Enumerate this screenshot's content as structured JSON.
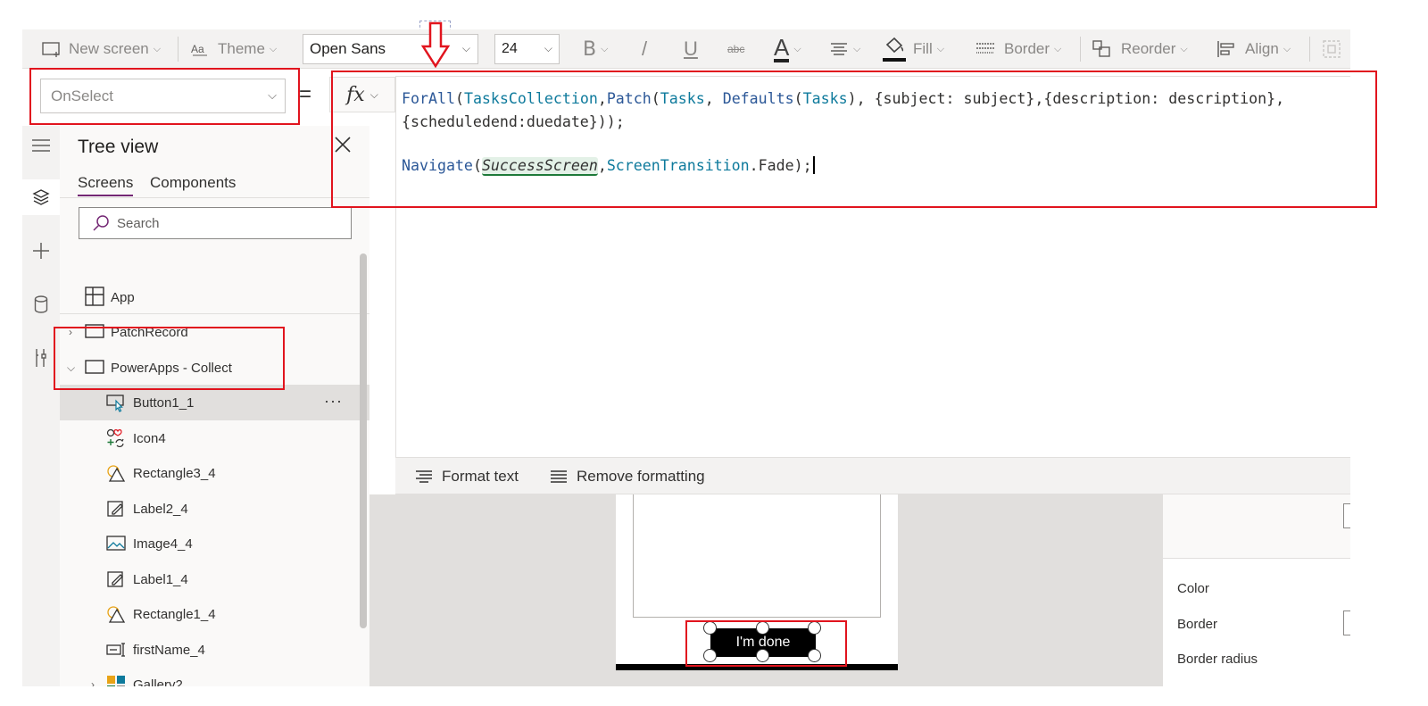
{
  "toolbar": {
    "new_screen": "New screen",
    "theme": "Theme",
    "font": "Open Sans",
    "font_size": "24",
    "bold": "B",
    "italic": "/",
    "underline": "U",
    "strikethrough": "abc",
    "font_color": "A",
    "fill": "Fill",
    "border": "Border",
    "reorder": "Reorder",
    "align": "Align"
  },
  "formula_bar": {
    "property": "OnSelect",
    "equals": "=",
    "fx": "fx",
    "code": {
      "l1_fn1": "ForAll",
      "l1_p1": "(",
      "l1_tk1": "TasksCollection",
      "l1_p2": ",",
      "l1_fn2": "Patch",
      "l1_p3": "(",
      "l1_tk2": "Tasks",
      "l1_p4": ", ",
      "l1_fn3": "Defaults",
      "l1_p5": "(",
      "l1_tk3": "Tasks",
      "l1_rest": "), {subject: subject},{description: description},",
      "l2": "{scheduledend:duedate}));",
      "l3_fn": "Navigate",
      "l3_p1": "(",
      "l3_screen": "SuccessScreen",
      "l3_p2": ",",
      "l3_tk": "ScreenTransition",
      "l3_rest": ".Fade);"
    }
  },
  "format_bar": {
    "format_text": "Format text",
    "remove_formatting": "Remove formatting"
  },
  "tree_view": {
    "title": "Tree view",
    "tabs": [
      "Screens",
      "Components"
    ],
    "search_placeholder": "Search",
    "items": [
      {
        "label": "App"
      },
      {
        "label": "PatchRecord"
      },
      {
        "label": "PowerApps - Collect"
      },
      {
        "label": "Button1_1"
      },
      {
        "label": "Icon4"
      },
      {
        "label": "Rectangle3_4"
      },
      {
        "label": "Label2_4"
      },
      {
        "label": "Image4_4"
      },
      {
        "label": "Label1_4"
      },
      {
        "label": "Rectangle1_4"
      },
      {
        "label": "firstName_4"
      },
      {
        "label": "Gallery2"
      }
    ]
  },
  "canvas": {
    "button_label": "I'm done"
  },
  "properties": {
    "color": "Color",
    "border": "Border",
    "border_radius": "Border radius"
  },
  "colors": {
    "annotation_red": "#e1141e",
    "accent_purple": "#742774",
    "function_blue": "#2b5797",
    "token_teal": "#0e7a9c"
  }
}
